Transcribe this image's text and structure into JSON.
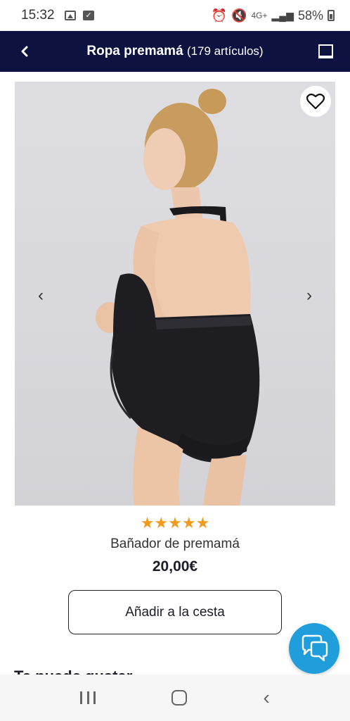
{
  "status_bar": {
    "time": "15:32",
    "network": "4G+",
    "battery": "58%"
  },
  "app_bar": {
    "title": "Ropa premamá",
    "count": "(179 artículos)"
  },
  "product": {
    "rating_stars": "★★★★★",
    "name": "Bañador de premamá",
    "price": "20,00€",
    "add_to_cart_label": "Añadir a la cesta"
  },
  "carousel": {
    "prev_glyph": "‹",
    "next_glyph": "›"
  },
  "section_peek": "Te puede gustar",
  "colors": {
    "app_bar_bg": "#0d1240",
    "star": "#f29a1d",
    "chat_button": "#1f9edb"
  },
  "icons": {
    "back": "chevron-left-icon",
    "view": "grid-view-icon",
    "favorite": "heart-outline-icon",
    "chat": "chat-bubbles-icon"
  }
}
